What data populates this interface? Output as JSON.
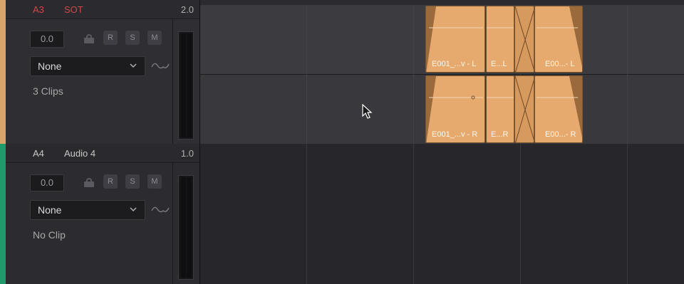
{
  "tracks": [
    {
      "id": "A3",
      "name": "SOT",
      "level": "2.0",
      "volume": "0.0",
      "buttons": {
        "r": "R",
        "s": "S",
        "m": "M"
      },
      "input": "None",
      "clip_count": "3 Clips",
      "color": "#d7a46c",
      "label_color": "#d04848"
    },
    {
      "id": "A4",
      "name": "Audio 4",
      "level": "1.0",
      "volume": "0.0",
      "buttons": {
        "r": "R",
        "s": "S",
        "m": "M"
      },
      "input": "None",
      "clip_count": "No Clip",
      "color": "#1f9a6a",
      "label_color": "#e0e0e0"
    }
  ],
  "clips": {
    "top": [
      {
        "label": "E001_...v - L"
      },
      {
        "label": "E...L"
      },
      {
        "label": "E00...- L"
      }
    ],
    "bottom": [
      {
        "label": "E001_...v - R"
      },
      {
        "label": "E...R"
      },
      {
        "label": "E00...- R"
      }
    ]
  },
  "colors": {
    "clip": "#e6aa6e",
    "clip_dark": "#9a6a3c"
  },
  "icons": [
    "lock-icon",
    "chevron-down-icon",
    "waveform-icon",
    "mouse-cursor-icon"
  ]
}
